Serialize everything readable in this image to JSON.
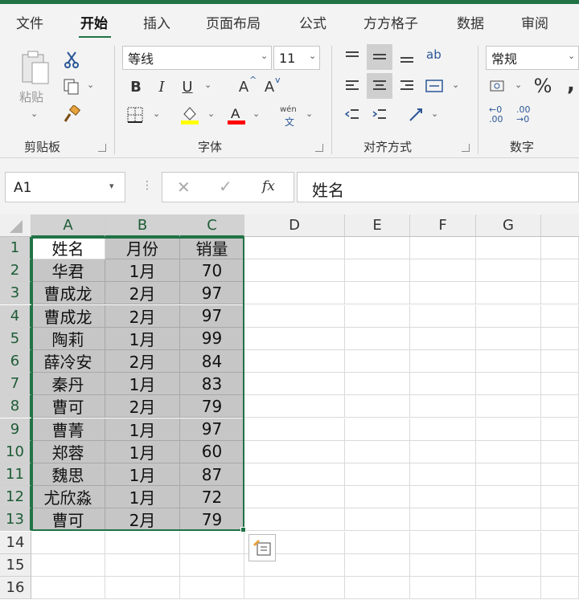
{
  "ribbon_tabs": [
    "文件",
    "开始",
    "插入",
    "页面布局",
    "公式",
    "方方格子",
    "数据",
    "审阅"
  ],
  "active_tab": "开始",
  "clipboard": {
    "paste_label": "粘贴",
    "group_label": "剪贴板"
  },
  "font": {
    "name": "等线",
    "size": "11",
    "group_label": "字体",
    "bold": "B",
    "italic": "I",
    "underline": "U",
    "grow": "A",
    "shrink": "A",
    "phonetic_top": "wén",
    "phonetic_bottom": "文",
    "fill_color": "#ffff00",
    "font_color": "#ff0000"
  },
  "alignment": {
    "group_label": "对齐方式",
    "wrap_glyph": "ab"
  },
  "number": {
    "format": "常规",
    "group_label": "数字",
    "percent": "%",
    "comma": ",",
    "inc_decimal_top": "←0",
    "inc_decimal_bottom": ".00",
    "dec_decimal_top": ".00",
    "dec_decimal_bottom": "→0"
  },
  "formula_bar": {
    "name_box": "A1",
    "fx_label": "fx",
    "content": "姓名"
  },
  "columns": [
    "A",
    "B",
    "C",
    "D",
    "E",
    "F",
    "G"
  ],
  "rows": [
    "1",
    "2",
    "3",
    "4",
    "5",
    "6",
    "7",
    "8",
    "9",
    "10",
    "11",
    "12",
    "13",
    "14",
    "15",
    "16"
  ],
  "table": [
    [
      "姓名",
      "月份",
      "销量"
    ],
    [
      "华君",
      "1月",
      "70"
    ],
    [
      "曹成龙",
      "2月",
      "97"
    ],
    [
      "曹成龙",
      "2月",
      "97"
    ],
    [
      "陶莉",
      "1月",
      "99"
    ],
    [
      "薛冷安",
      "2月",
      "84"
    ],
    [
      "秦丹",
      "1月",
      "83"
    ],
    [
      "曹可",
      "2月",
      "79"
    ],
    [
      "曹菁",
      "1月",
      "97"
    ],
    [
      "郑蓉",
      "1月",
      "60"
    ],
    [
      "魏思",
      "1月",
      "87"
    ],
    [
      "尤欣淼",
      "1月",
      "72"
    ],
    [
      "曹可",
      "2月",
      "79"
    ]
  ],
  "accent_color": "#217346"
}
